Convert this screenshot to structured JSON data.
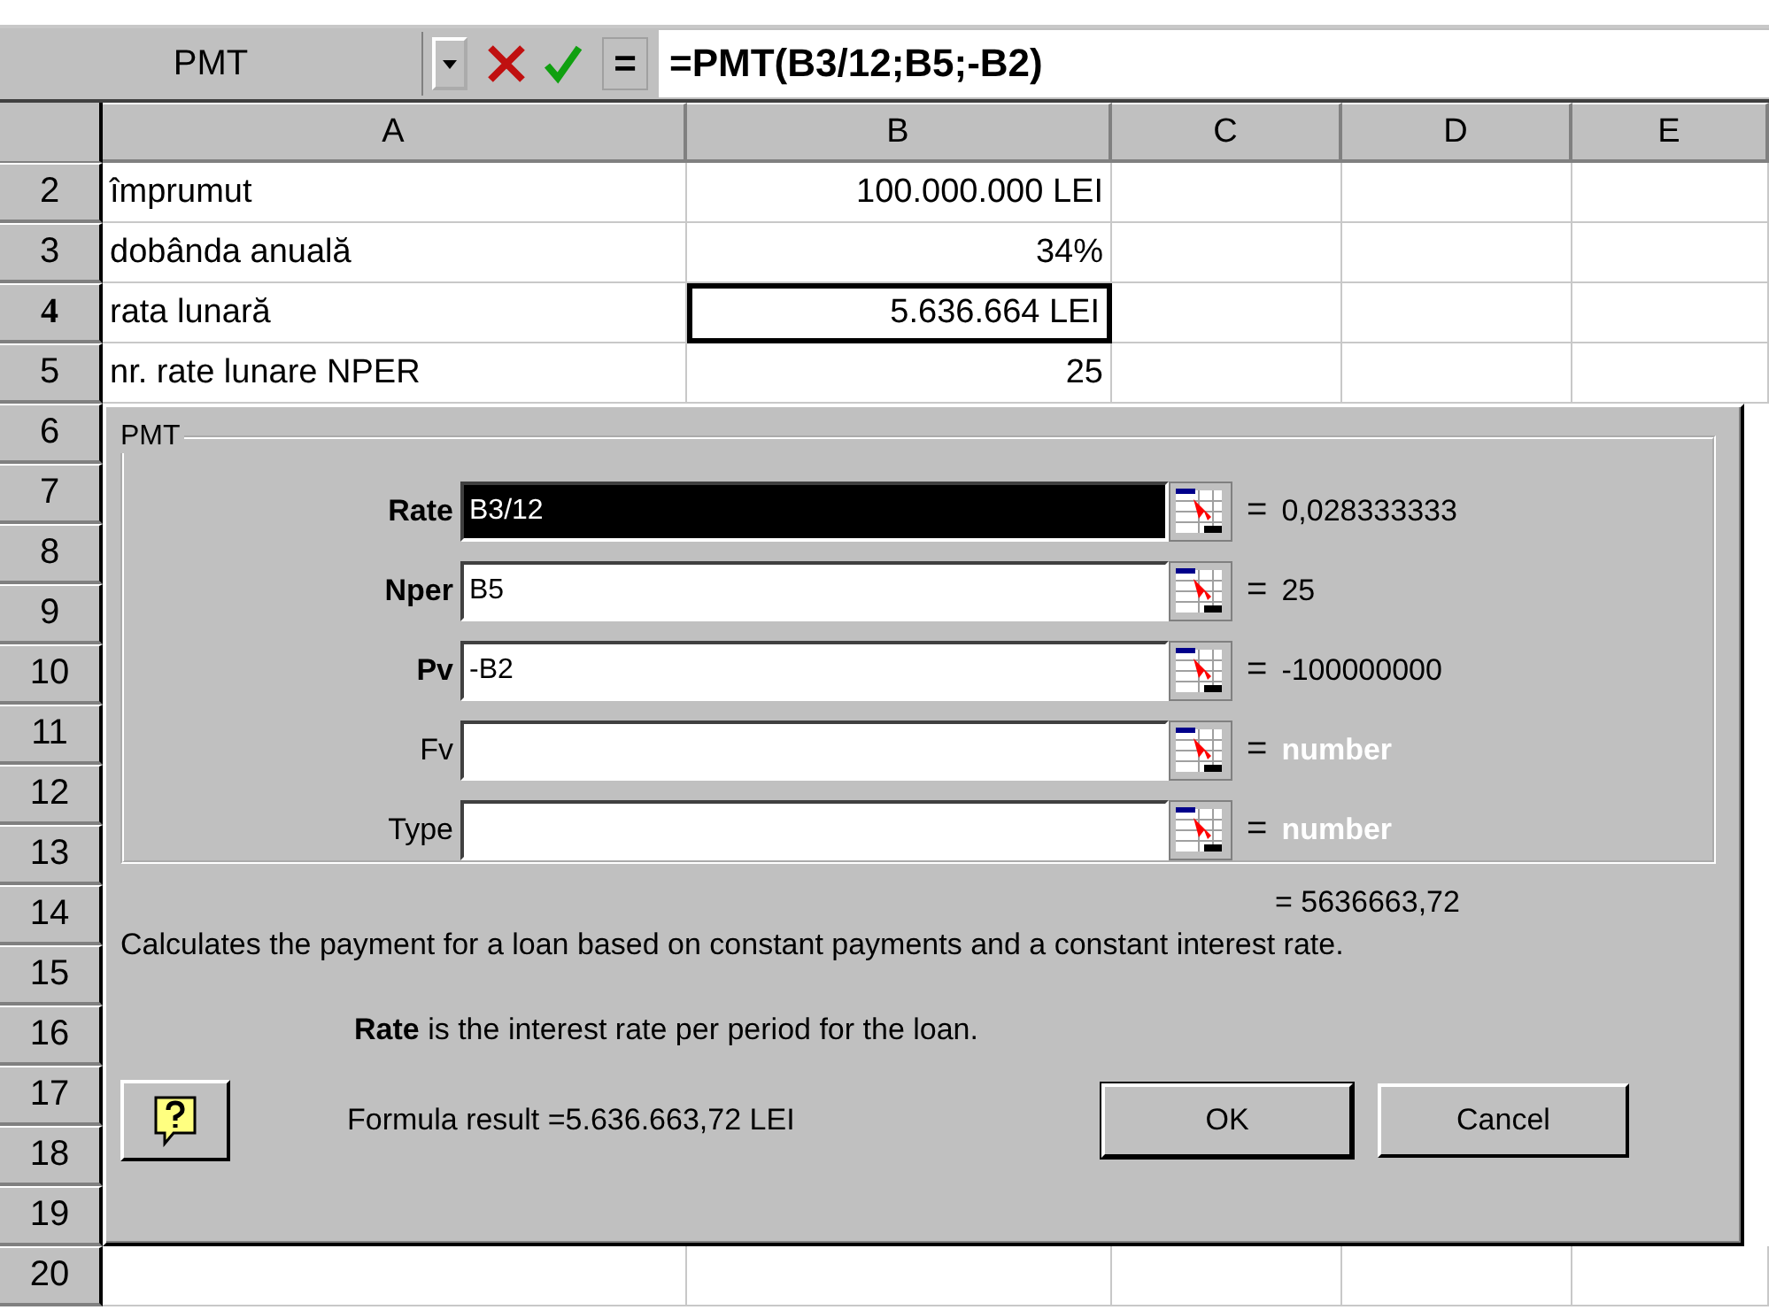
{
  "name_box": "PMT",
  "edit_formula_button": "=",
  "formula": "=PMT(B3/12;B5;-B2)",
  "columns": [
    "A",
    "B",
    "C",
    "D",
    "E"
  ],
  "rows": [
    {
      "number": "2",
      "selected": false,
      "cells": {
        "a": "împrumut",
        "b": "100.000.000 LEI"
      }
    },
    {
      "number": "3",
      "selected": false,
      "cells": {
        "a": "dobânda anuală",
        "b": "34%"
      }
    },
    {
      "number": "4",
      "selected": true,
      "cells": {
        "a": "rata lunară",
        "b": "5.636.664 LEI"
      }
    },
    {
      "number": "5",
      "selected": false,
      "cells": {
        "a": "nr. rate lunare NPER",
        "b": "25"
      }
    },
    {
      "number": "6",
      "selected": false
    },
    {
      "number": "7",
      "selected": false
    },
    {
      "number": "8",
      "selected": false
    },
    {
      "number": "9",
      "selected": false
    },
    {
      "number": "10",
      "selected": false
    },
    {
      "number": "11",
      "selected": false
    },
    {
      "number": "12",
      "selected": false
    },
    {
      "number": "13",
      "selected": false
    },
    {
      "number": "14",
      "selected": false
    },
    {
      "number": "15",
      "selected": false
    },
    {
      "number": "16",
      "selected": false
    },
    {
      "number": "17",
      "selected": false
    },
    {
      "number": "18",
      "selected": false
    },
    {
      "number": "19",
      "selected": false
    },
    {
      "number": "20",
      "selected": false,
      "cells": {}
    }
  ],
  "dialog": {
    "group_title": "PMT",
    "arguments": [
      {
        "label": "Rate",
        "required": true,
        "value": "B3/12",
        "highlighted": true,
        "sign": "=",
        "result": "0,028333333",
        "placeholder_result": false
      },
      {
        "label": "Nper",
        "required": true,
        "value": "B5",
        "highlighted": false,
        "sign": "=",
        "result": "25",
        "placeholder_result": false
      },
      {
        "label": "Pv",
        "required": true,
        "value": "-B2",
        "highlighted": false,
        "sign": "=",
        "result": "-100000000",
        "placeholder_result": false
      },
      {
        "label": "Fv",
        "required": false,
        "highlighted": false,
        "sign": "=",
        "result": "number",
        "placeholder_result": true
      },
      {
        "label": "Type",
        "required": false,
        "highlighted": false,
        "sign": "=",
        "result": "number",
        "placeholder_result": true
      }
    ],
    "total_result": "= 5636663,72",
    "description": "Calculates the payment for a loan based on constant payments and a constant interest rate.",
    "argument_help": "**Rate** is the interest rate per period for the loan.",
    "formula_result": "Formula result =5.636.663,72 LEI",
    "buttons": [
      "OK",
      "Cancel"
    ]
  }
}
